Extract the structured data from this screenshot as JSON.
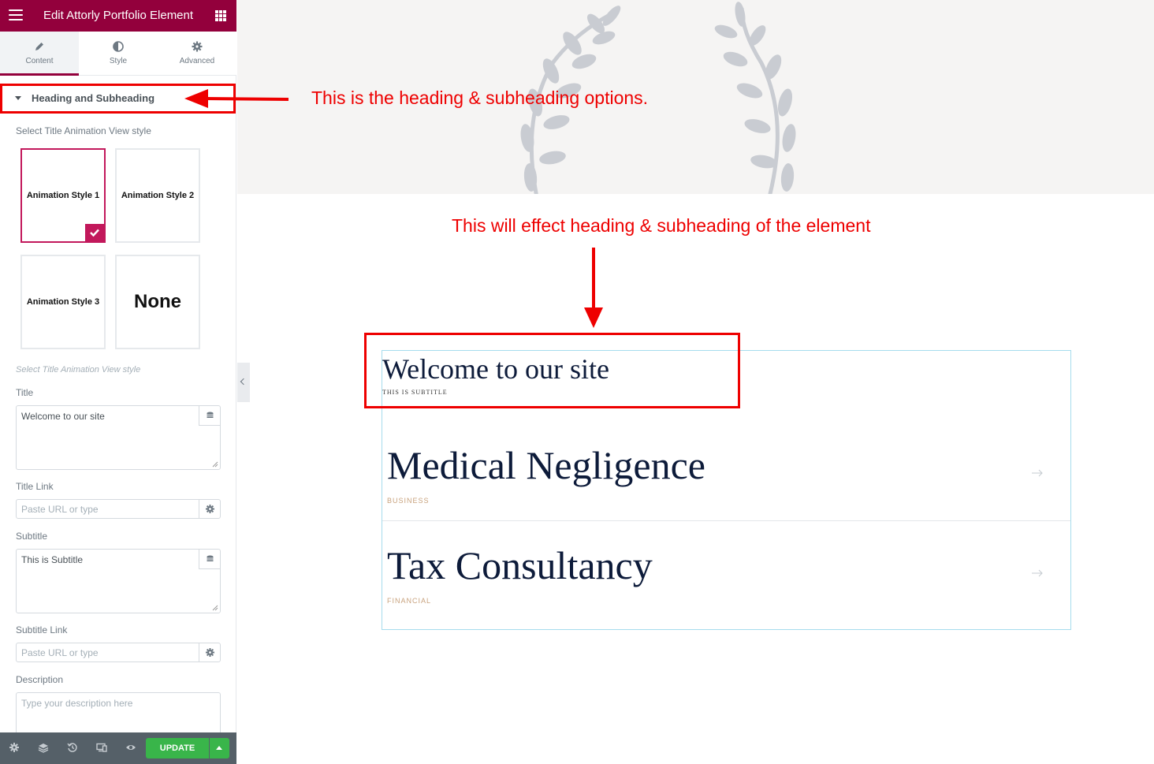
{
  "panel": {
    "title": "Edit Attorly Portfolio Element",
    "tabs": [
      {
        "label": "Content",
        "icon": "pencil-icon",
        "active": true
      },
      {
        "label": "Style",
        "icon": "half-circle-icon",
        "active": false
      },
      {
        "label": "Advanced",
        "icon": "gear-icon",
        "active": false
      }
    ],
    "section_title": "Heading and Subheading",
    "animation_label": "Select Title Animation View style",
    "animation_styles": [
      {
        "label": "Animation Style 1",
        "selected": true
      },
      {
        "label": "Animation Style 2",
        "selected": false
      },
      {
        "label": "Animation Style 3",
        "selected": false
      },
      {
        "label": "None",
        "selected": false
      }
    ],
    "animation_help": "Select Title Animation View style",
    "title_label": "Title",
    "title_value": "Welcome to our site",
    "title_link_label": "Title Link",
    "title_link_placeholder": "Paste URL or type",
    "subtitle_label": "Subtitle",
    "subtitle_value": "This is Subtitle",
    "subtitle_link_label": "Subtitle Link",
    "subtitle_link_placeholder": "Paste URL or type",
    "description_label": "Description",
    "description_placeholder": "Type your description here",
    "update_label": "UPDATE"
  },
  "annotations": {
    "heading_options": "This is the heading & subheading options.",
    "effect": "This will effect heading & subheading of the element"
  },
  "preview": {
    "heading": "Welcome to our site",
    "subheading": "THIS IS SUBTITLE",
    "items": [
      {
        "title": "Medical Negligence",
        "category": "BUSINESS"
      },
      {
        "title": "Tax Consultancy",
        "category": "FINANCIAL"
      }
    ]
  },
  "colors": {
    "panel_header": "#93003c",
    "selected_accent": "#c2185b",
    "update_button": "#39b54a",
    "annotation": "#ee0000",
    "portfolio_border": "#a6dced",
    "title_navy": "#0d1b3a",
    "category_tan": "#c8a27d"
  }
}
